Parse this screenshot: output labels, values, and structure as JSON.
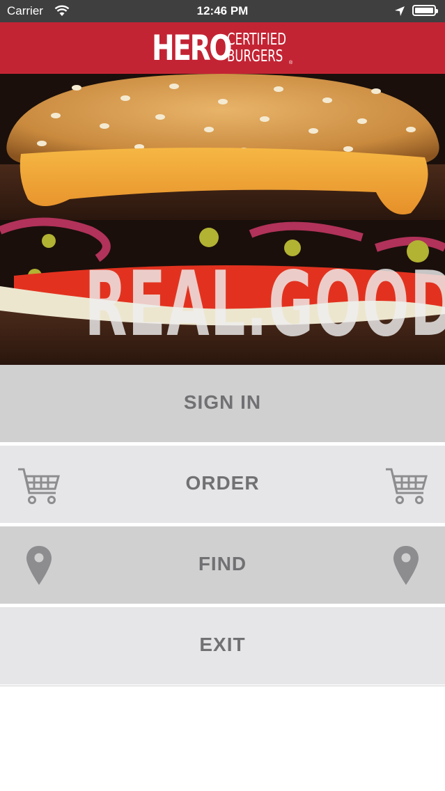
{
  "status_bar": {
    "carrier": "Carrier",
    "time": "12:46 PM"
  },
  "header": {
    "logo_main": "HERO",
    "logo_line1": "CERTIFIED",
    "logo_line2": "BURGERS",
    "logo_reg": "®"
  },
  "hero": {
    "tagline": "REAL.GOOD."
  },
  "menu": {
    "sign_in": "SIGN IN",
    "order": "ORDER",
    "find": "FIND",
    "exit": "EXIT"
  },
  "colors": {
    "brand_red": "#c32434",
    "menu_text": "#717174",
    "menu_dark": "#d0d0d1",
    "menu_light": "#e6e6e8"
  }
}
